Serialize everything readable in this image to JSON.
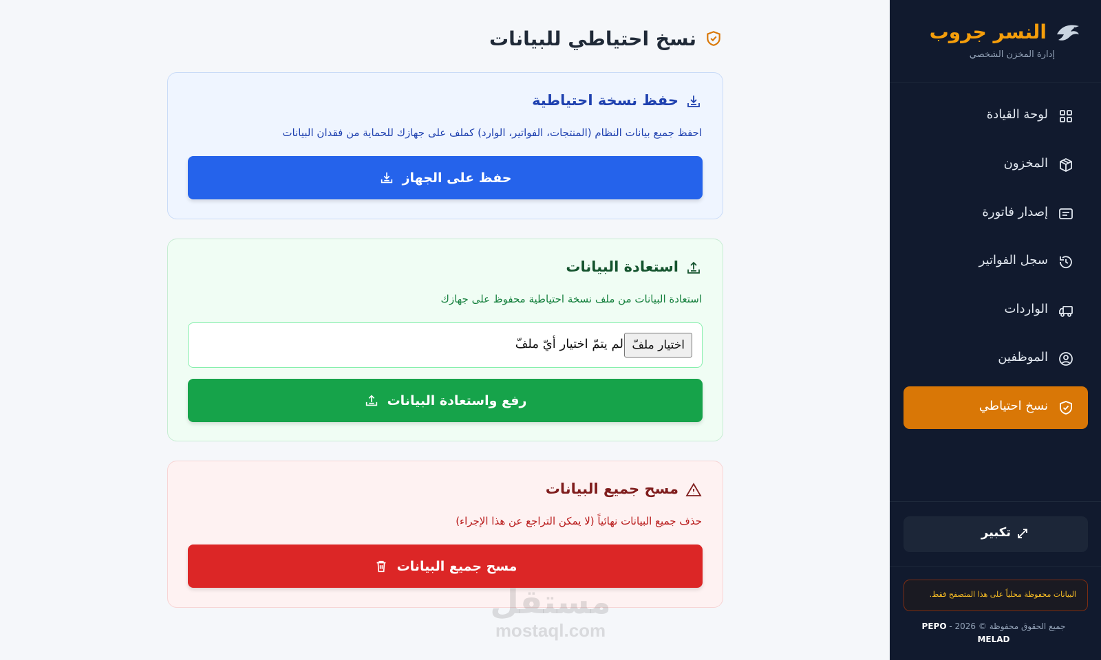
{
  "sidebar": {
    "brand_title": "النسر جروب",
    "brand_subtitle": "إدارة المخزن الشخصي",
    "items": [
      {
        "label": "لوحة القيادة",
        "icon": "grid-icon"
      },
      {
        "label": "المخزون",
        "icon": "box-icon"
      },
      {
        "label": "إصدار فاتورة",
        "icon": "receipt-icon"
      },
      {
        "label": "سجل الفواتير",
        "icon": "history-icon"
      },
      {
        "label": "الواردات",
        "icon": "truck-icon"
      },
      {
        "label": "الموظفين",
        "icon": "user-circle-icon"
      },
      {
        "label": "نسخ احتياطي",
        "icon": "shield-check-icon",
        "active": true
      }
    ],
    "expand_label": "تكبير",
    "notice": "البيانات محفوظة محلياً على هذا المتصفح فقط.",
    "copyright_text": "جميع الحقوق محفوظة © 2026 -",
    "copyright_name1": "PEPO",
    "copyright_name2": "MELAD"
  },
  "main": {
    "title": "نسخ احتياطي للبيانات",
    "backup": {
      "heading": "حفظ نسخة احتياطية",
      "description": "احفظ جميع بيانات النظام (المنتجات، الفواتير، الوارد) كملف على جهازك للحماية من فقدان البيانات",
      "button": "حفظ على الجهاز"
    },
    "restore": {
      "heading": "استعادة البيانات",
      "description": "استعادة البيانات من ملف نسخة احتياطية محفوظ على جهازك",
      "file_button": "اختيار ملفّ",
      "file_status": "لم يتمّ اختيار أيّ ملفّ",
      "button": "رفع واستعادة البيانات"
    },
    "wipe": {
      "heading": "مسح جميع البيانات",
      "description": "حذف جميع البيانات نهائياً (لا يمكن التراجع عن هذا الإجراء)",
      "button": "مسح جميع البيانات"
    }
  },
  "watermark": {
    "line1": "مستقل",
    "line2": "mostaql.com"
  },
  "colors": {
    "sidebar_bg": "#111a2e",
    "accent": "#d97706",
    "brand": "#f59e0b",
    "blue": "#2563eb",
    "green": "#16a34a",
    "red": "#dc2626"
  }
}
